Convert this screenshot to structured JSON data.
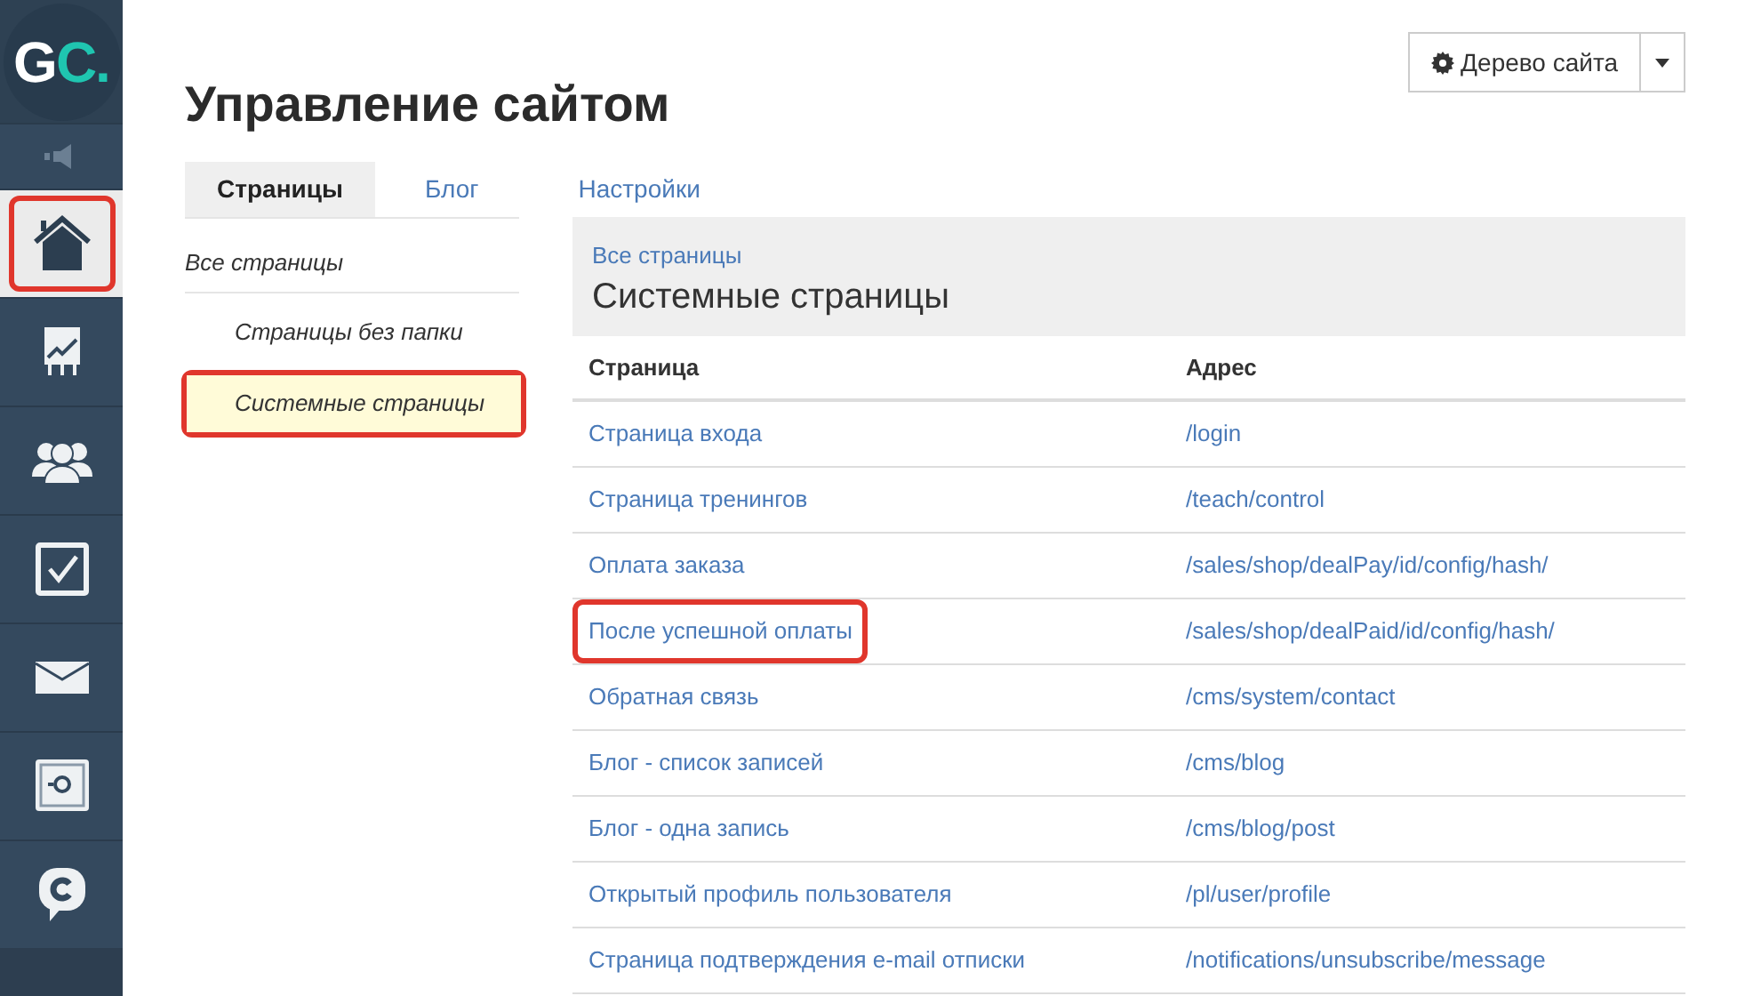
{
  "logo": {
    "text": "GC",
    "dot": "."
  },
  "sidebar": {
    "items": [
      {
        "kind": "speaker",
        "selected": false,
        "highlighted": false
      },
      {
        "kind": "home",
        "selected": true,
        "highlighted": true
      },
      {
        "kind": "chart",
        "selected": false,
        "highlighted": false
      },
      {
        "kind": "people",
        "selected": false,
        "highlighted": false
      },
      {
        "kind": "check",
        "selected": false,
        "highlighted": false
      },
      {
        "kind": "mail",
        "selected": false,
        "highlighted": false
      },
      {
        "kind": "safe",
        "selected": false,
        "highlighted": false
      },
      {
        "kind": "chat",
        "selected": false,
        "highlighted": false
      }
    ]
  },
  "title": "Управление сайтом",
  "site_tree_button": {
    "label": "Дерево сайта"
  },
  "tabs": [
    {
      "label": "Страницы",
      "selected": true
    },
    {
      "label": "Блог",
      "selected": false
    },
    {
      "label": "Настройки",
      "selected": false
    }
  ],
  "folders": [
    {
      "label": "Все страницы",
      "selected": false,
      "highlighted": false,
      "children": [
        {
          "label": "Страницы без папки",
          "selected": false,
          "highlighted": false
        },
        {
          "label": "Системные страницы",
          "selected": true,
          "highlighted": true
        }
      ]
    }
  ],
  "panel": {
    "breadcrumb": "Все страницы",
    "heading": "Системные страницы"
  },
  "table": {
    "columns": [
      "Страница",
      "Адрес"
    ],
    "rows": [
      {
        "page": "Страница входа",
        "address": "/login",
        "highlighted": false
      },
      {
        "page": "Страница тренингов",
        "address": "/teach/control",
        "highlighted": false
      },
      {
        "page": "Оплата заказа",
        "address": "/sales/shop/dealPay/id/config/hash/",
        "highlighted": false
      },
      {
        "page": "После успешной оплаты",
        "address": "/sales/shop/dealPaid/id/config/hash/",
        "highlighted": true
      },
      {
        "page": "Обратная связь",
        "address": "/cms/system/contact",
        "highlighted": false
      },
      {
        "page": "Блог - список записей",
        "address": "/cms/blog",
        "highlighted": false
      },
      {
        "page": "Блог - одна запись",
        "address": "/cms/blog/post",
        "highlighted": false
      },
      {
        "page": "Открытый профиль пользователя",
        "address": "/pl/user/profile",
        "highlighted": false
      },
      {
        "page": "Страница подтверждения e-mail отписки",
        "address": "/notifications/unsubscribe/message",
        "highlighted": false
      }
    ]
  }
}
